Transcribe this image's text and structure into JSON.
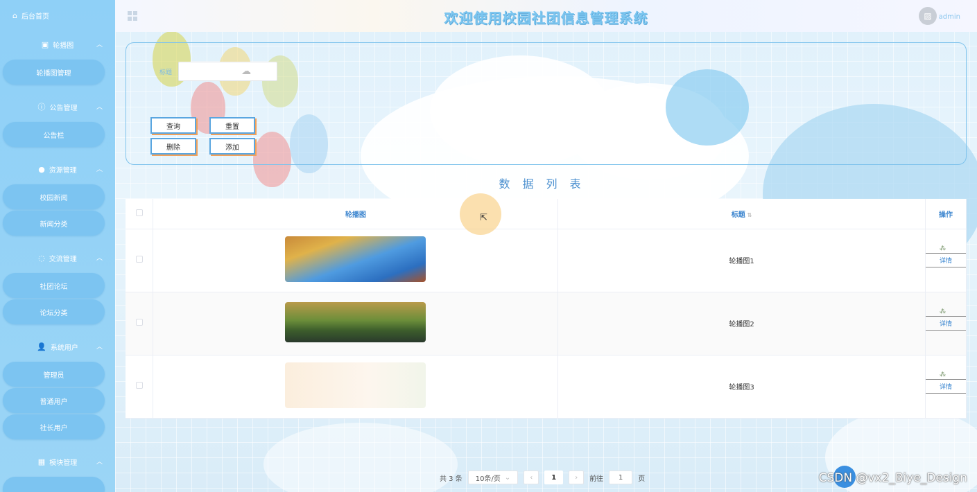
{
  "header": {
    "title": "欢迎使用校园社团信息管理系统",
    "user": "admin"
  },
  "sidebar": {
    "home": "后台首页",
    "groups": [
      {
        "label": "轮播图",
        "items": [
          "轮播图管理"
        ]
      },
      {
        "label": "公告管理",
        "items": [
          "公告栏"
        ]
      },
      {
        "label": "资源管理",
        "items": [
          "校园新闻",
          "新闻分类"
        ]
      },
      {
        "label": "交流管理",
        "items": [
          "社团论坛",
          "论坛分类"
        ]
      },
      {
        "label": "系统用户",
        "items": [
          "管理员",
          "普通用户",
          "社长用户"
        ]
      },
      {
        "label": "模块管理",
        "items": []
      }
    ]
  },
  "search": {
    "label": "标题",
    "value": ""
  },
  "buttons": {
    "query": "查询",
    "reset": "重置",
    "delete": "删除",
    "add": "添加"
  },
  "list_title": "数据列表",
  "table": {
    "headers": {
      "image": "轮播图",
      "title": "标题",
      "op": "操作"
    },
    "rows": [
      {
        "title": "轮播图1",
        "op": "详情"
      },
      {
        "title": "轮播图2",
        "op": "详情"
      },
      {
        "title": "轮播图3",
        "op": "详情"
      }
    ]
  },
  "pager": {
    "total": "共 3 条",
    "size": "10条/页",
    "current": "1",
    "goto_prefix": "前往",
    "goto_value": "1",
    "goto_suffix": "页"
  },
  "watermark": "CSDN @vx2_Biye_Design"
}
